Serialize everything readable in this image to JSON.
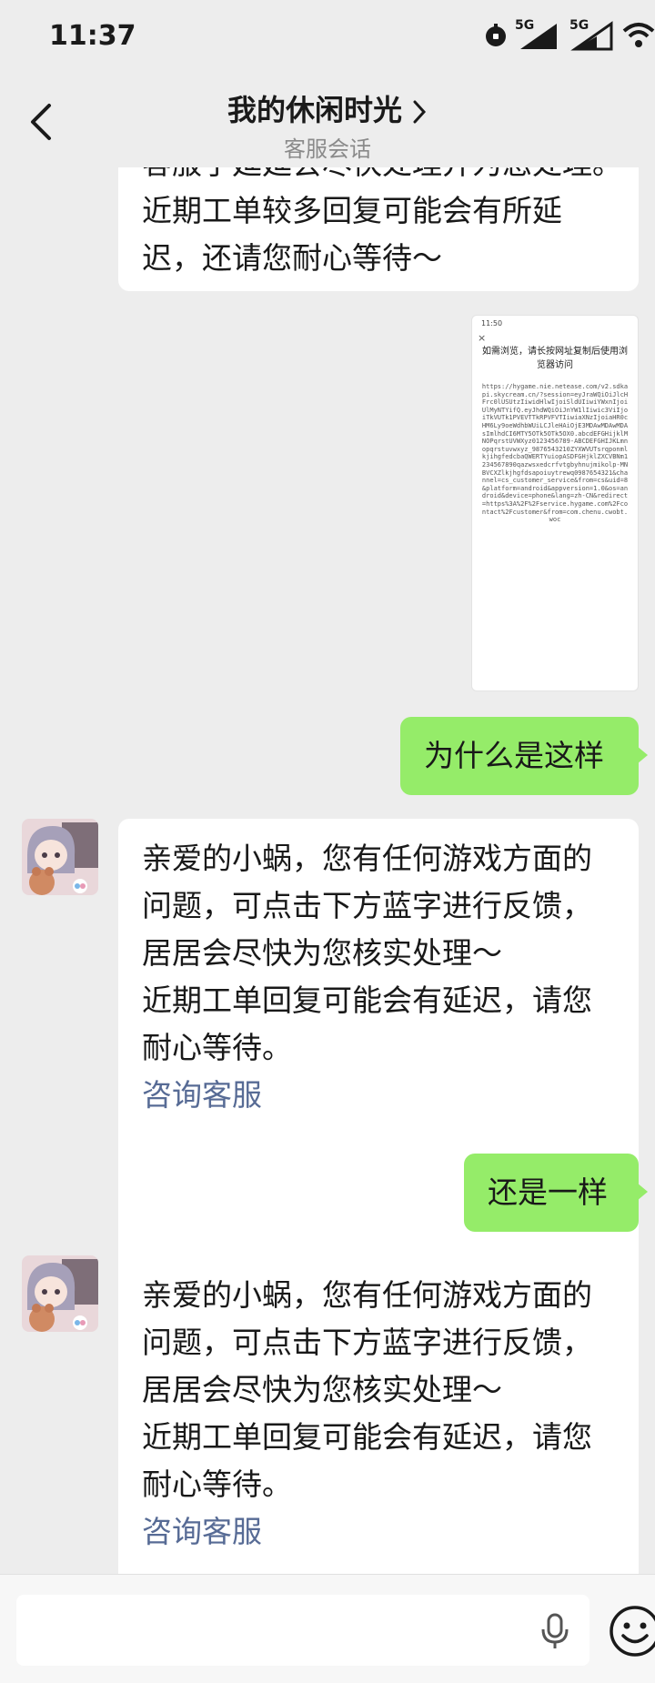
{
  "status_bar": {
    "time": "11:37",
    "signal_1_label": "5G",
    "signal_2_label": "5G"
  },
  "header": {
    "title": "我的休闲时光",
    "subtitle": "客服会话"
  },
  "messages": [
    {
      "direction": "in",
      "lines": [
        "客服了延延会尽快处理并为您处理。",
        "近期工单较多回复可能会有所延",
        "迟，还请您耐心等待～"
      ]
    },
    {
      "direction": "out",
      "type": "image",
      "screenshot": {
        "time": "11:50",
        "close": "×",
        "title": "如需浏览，请长按网址复制后使用浏览器访问",
        "url": "https://hygame.nie.netease.com/v2.sdkapi.skycream.cn/?session=eyJraWQiOiJlcHFrc0lUSUtzIiwidHlwIjoiSldUIiwiYWxnIjoiUlMyNTYifQ.eyJhdWQiOiJnYW1lIiwic3ViIjoiTkVUTk1PVEVTTkRPVFVTIiwiaXNzIjoiaHR0cHM6Ly9oeWdhbWUiLCJleHAiOjE3MDAwMDAwMDAsImlhdCI6MTY5OTk5OTk5OX0.abcdEFGHijklMNOPqrstUVWXyz0123456789-ABCDEFGHIJKLmnopqrstuvwxyz_9876543210ZYXWVUTsrqponmlkjihgfedcbaQWERTYuiopASDFGHjklZXCVBNm1234567890qazwsxedcrfvtgbyhnujmikolp-MNBVCXZlkjhgfdsapoiuytrewq0987654321&channel=cs_customer_service&from=cs&uid=8&platform=android&appversion=1.0&os=android&device=phone&lang=zh-CN&redirect=https%3A%2F%2Fservice.hygame.com%2Fcontact%2Fcustomer&from=com.chenu.cwobt.woc"
      }
    },
    {
      "direction": "out",
      "type": "text",
      "text": "为什么是这样"
    },
    {
      "direction": "in",
      "lines": [
        "亲爱的小蜗，您有任何游戏方面的",
        "问题，可点击下方蓝字进行反馈，",
        "居居会尽快为您核实处理～",
        "近期工单回复可能会有延迟，请您",
        "耐心等待。"
      ],
      "link": "咨询客服"
    },
    {
      "direction": "out",
      "type": "text",
      "text": "还是一样"
    },
    {
      "direction": "in",
      "lines": [
        "亲爱的小蜗，您有任何游戏方面的",
        "问题，可点击下方蓝字进行反馈，",
        "居居会尽快为您核实处理～",
        "近期工单回复可能会有延迟，请您",
        "耐心等待。"
      ],
      "link": "咨询客服"
    }
  ],
  "input_bar": {
    "placeholder": "",
    "mic_icon": "microphone-icon",
    "emoji_icon": "emoji-icon"
  },
  "colors": {
    "outgoing_bubble": "#95ec69",
    "incoming_bubble": "#ffffff",
    "link": "#576b95",
    "background": "#ededed"
  }
}
